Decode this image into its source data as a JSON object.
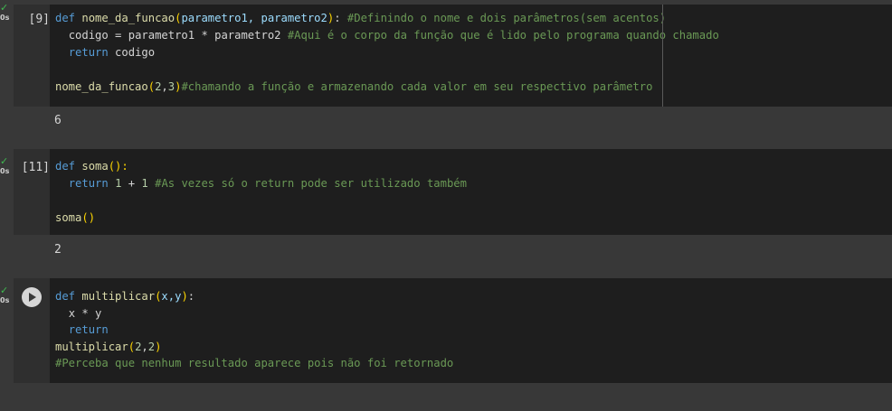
{
  "cells": [
    {
      "status_icon": "checkmark-icon",
      "time": "0s",
      "execution_count": "[9]",
      "lines": [
        {
          "indent": "",
          "t1": "def",
          "t2": " ",
          "t3": "nome_da_funcao",
          "t4": "(",
          "t5": "parametro1, parametro2",
          "t6": ")",
          "t7": ": ",
          "t8": "#Definindo o nome e dois parâmetros(sem acentos)"
        },
        {
          "indent": "  ",
          "t1": "codigo",
          "t2": " = parametro1 * parametro2 ",
          "t3": "#Aqui é o corpo da função que é lido pelo programa quando chamado"
        },
        {
          "indent": "  ",
          "t1": "return",
          "t2": " codigo"
        },
        {
          "blank": ""
        },
        {
          "t1": "nome_da_funcao",
          "t2": "(",
          "t3": "2",
          "t4": ",",
          "t5": "3",
          "t6": ")",
          "t7": "#chamando a função e armazenando cada valor em seu respectivo parâmetro"
        }
      ],
      "output": "6"
    },
    {
      "status_icon": "checkmark-icon",
      "time": "0s",
      "execution_count": "[11]",
      "lines": [
        {
          "t1": "def",
          "t2": " ",
          "t3": "soma",
          "t4": "():"
        },
        {
          "indent": "  ",
          "t1": "return",
          "t2": " ",
          "t3": "1",
          "t4": " + ",
          "t5": "1",
          "t6": " ",
          "t7": "#As vezes só o return pode ser utilizado também"
        },
        {
          "blank": ""
        },
        {
          "t1": "soma",
          "t2": "()"
        }
      ],
      "output": "2"
    },
    {
      "status_icon": "checkmark-icon",
      "time": "0s",
      "run_icon": "play-icon",
      "lines": [
        {
          "t1": "def",
          "t2": " ",
          "t3": "multiplicar",
          "t4": "(",
          "t5": "x,y",
          "t6": ")",
          "t7": ":"
        },
        {
          "indent": "  ",
          "t1": "x * y"
        },
        {
          "indent": "  ",
          "t1": "return"
        },
        {
          "t1": "multiplicar",
          "t2": "(",
          "t3": "2",
          "t4": ",",
          "t5": "2",
          "t6": ")"
        },
        {
          "t1": "#Perceba que nenhum resultado aparece pois não foi retornado"
        }
      ]
    }
  ]
}
